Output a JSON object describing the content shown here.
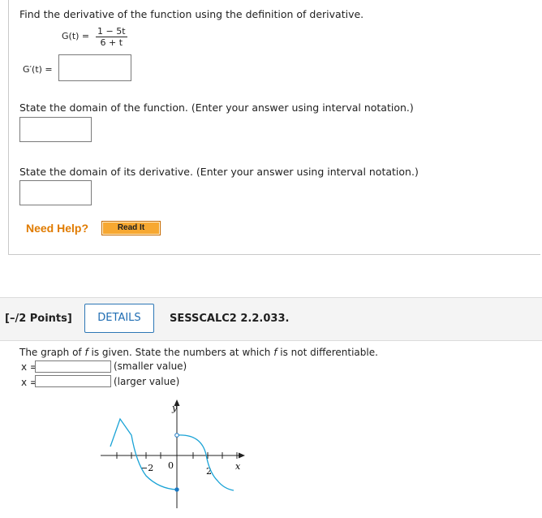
{
  "problem1": {
    "prompt": "Find the derivative of the function using the definition of derivative.",
    "function_lhs": "G(t)",
    "equals": "=",
    "numerator": "1 − 5t",
    "denominator": "6 + t",
    "derivative_label": "G′(t)",
    "domain_function_prompt": "State the domain of the function. (Enter your answer using interval notation.)",
    "domain_derivative_prompt": "State the domain of its derivative. (Enter your answer using interval notation.)",
    "need_help": "Need Help?",
    "read_it": "Read It"
  },
  "problem2": {
    "points": "[–/2 Points]",
    "details": "DETAILS",
    "code": "SESSCALC2 2.2.033.",
    "prompt_a": "The graph of ",
    "prompt_f1": "f",
    "prompt_b": " is given. State the numbers at which ",
    "prompt_f2": "f",
    "prompt_c": " is not differentiable.",
    "x_label": "x =",
    "smaller": "(smaller value)",
    "larger": "(larger value)",
    "graph": {
      "y_axis_label": "y",
      "x_axis_label": "x",
      "tick_neg2": "−2",
      "tick_0": "0",
      "tick_2": "2"
    }
  }
}
